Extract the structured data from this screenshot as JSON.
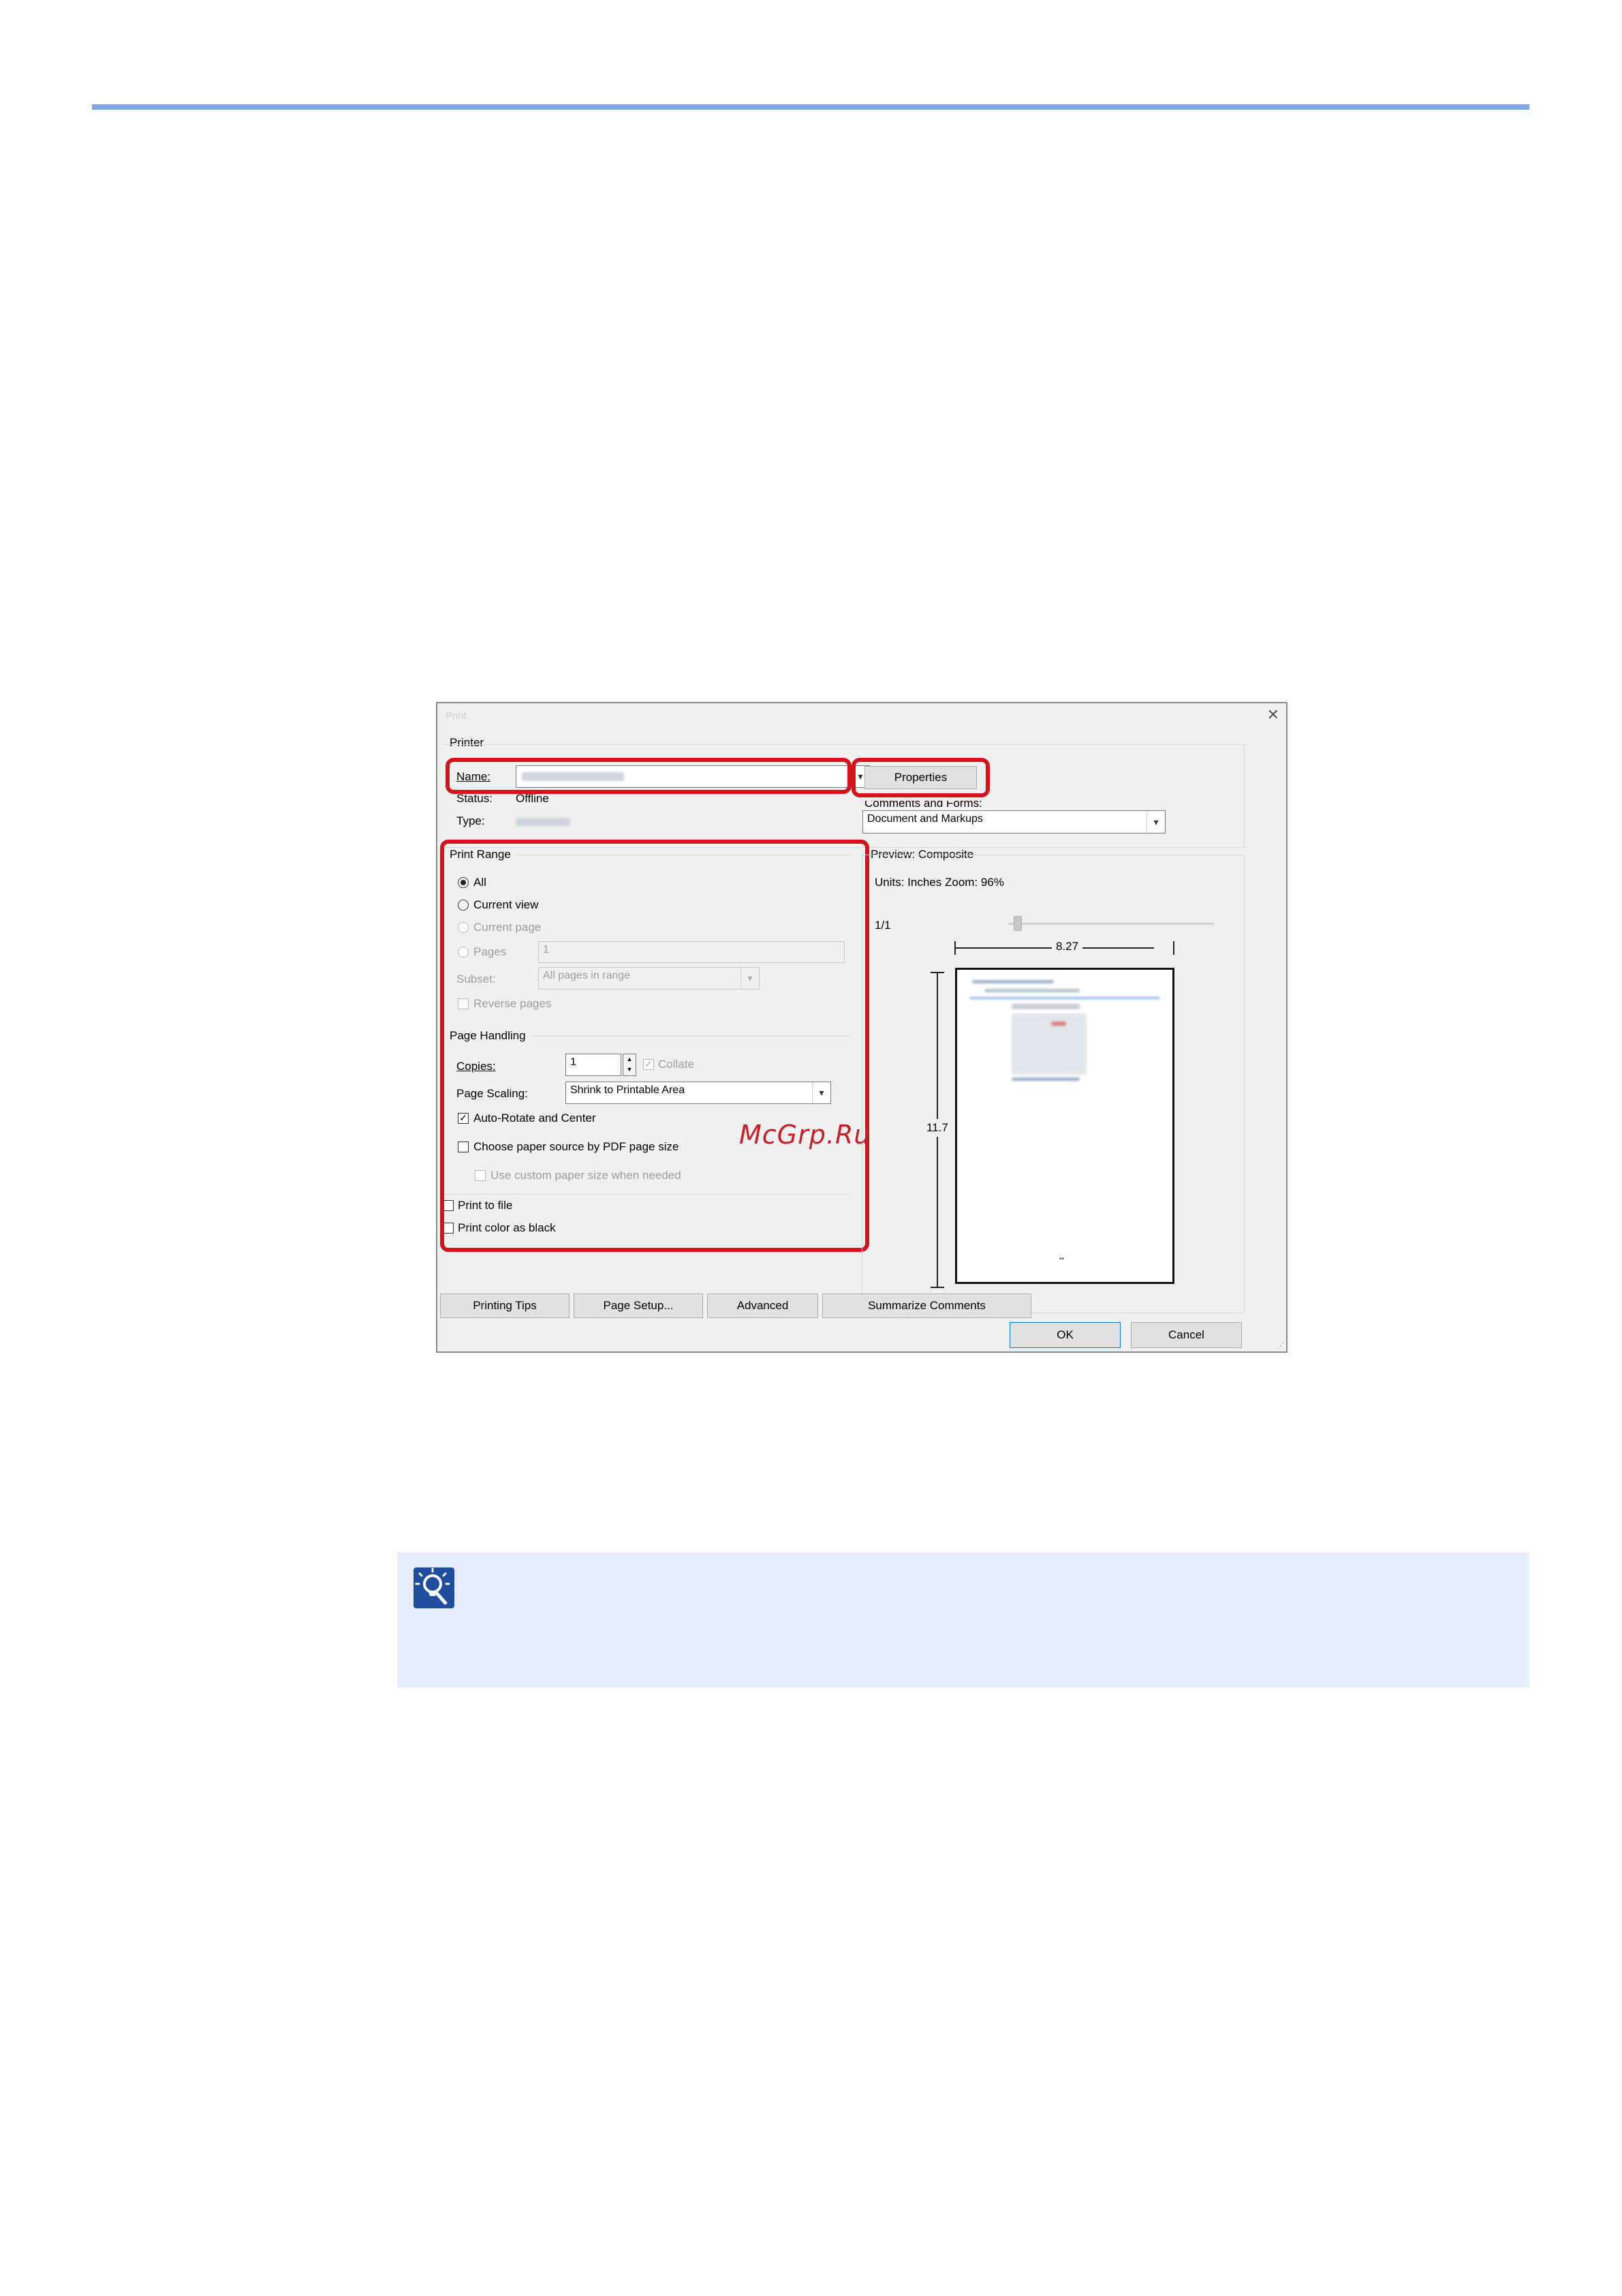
{
  "dialog": {
    "title": "Print",
    "close_glyph": "✕",
    "printer": {
      "group_label": "Printer",
      "name_label": "Name:",
      "name_value": "",
      "status_label": "Status:",
      "status_value": "Offline",
      "type_label": "Type:",
      "type_value": "",
      "properties_button": "Properties",
      "comments_label": "Comments and Forms:",
      "comments_value": "Document and Markups"
    },
    "print_range": {
      "group_label": "Print Range",
      "all": "All",
      "current_view": "Current view",
      "current_page": "Current page",
      "pages": "Pages",
      "pages_value": "1",
      "subset_label": "Subset:",
      "subset_value": "All pages in range",
      "reverse_pages": "Reverse pages"
    },
    "page_handling": {
      "group_label": "Page Handling",
      "copies_label": "Copies:",
      "copies_value": "1",
      "collate": "Collate",
      "page_scaling_label": "Page Scaling:",
      "page_scaling_value": "Shrink to Printable Area",
      "auto_rotate": "Auto-Rotate and Center",
      "choose_paper_source": "Choose paper source by PDF page size",
      "use_custom_paper": "Use custom paper size when needed"
    },
    "print_to_file": "Print to file",
    "print_color_as_black": "Print color as black",
    "preview": {
      "group_label": "Preview: Composite",
      "units_zoom": "Units: Inches Zoom:  96%",
      "page_counter": "1/1",
      "width_label": "8.27",
      "height_label": "11.7",
      "footer_mark": "▪▪"
    },
    "buttons": {
      "printing_tips": "Printing Tips",
      "page_setup": "Page Setup...",
      "advanced": "Advanced",
      "summarize_comments": "Summarize Comments",
      "ok": "OK",
      "cancel": "Cancel"
    }
  },
  "watermark": "McGrp.Ru",
  "colors": {
    "highlight": "#d2141c",
    "rule": "#7fa6e6",
    "note_bg": "#e5ecfa",
    "note_icon": "#1f4e9e"
  }
}
